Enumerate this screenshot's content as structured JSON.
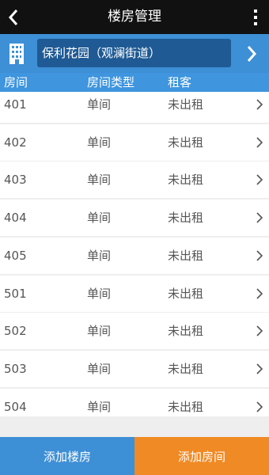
{
  "header": {
    "title": "楼房管理",
    "back_icon": "chevron-left-icon",
    "more_icon": "more-vertical-icon"
  },
  "building": {
    "icon": "building-icon",
    "name": "保利花园（观澜街道）",
    "next_icon": "chevron-right-icon"
  },
  "table": {
    "columns": [
      "房间",
      "房间类型",
      "租客"
    ],
    "rows": [
      {
        "room": "401",
        "type": "单间",
        "tenant": "未出租"
      },
      {
        "room": "402",
        "type": "单间",
        "tenant": "未出租"
      },
      {
        "room": "403",
        "type": "单间",
        "tenant": "未出租"
      },
      {
        "room": "404",
        "type": "单间",
        "tenant": "未出租"
      },
      {
        "room": "405",
        "type": "单间",
        "tenant": "未出租"
      },
      {
        "room": "501",
        "type": "单间",
        "tenant": "未出租"
      },
      {
        "room": "502",
        "type": "单间",
        "tenant": "未出租"
      },
      {
        "room": "503",
        "type": "单间",
        "tenant": "未出租"
      },
      {
        "room": "504",
        "type": "单间",
        "tenant": "未出租"
      }
    ]
  },
  "actions": {
    "add_building": "添加楼房",
    "add_room": "添加房间"
  },
  "colors": {
    "topbar": "#111111",
    "primary_blue": "#3d8fd6",
    "dark_blue": "#1f5a94",
    "orange": "#f08a24"
  }
}
